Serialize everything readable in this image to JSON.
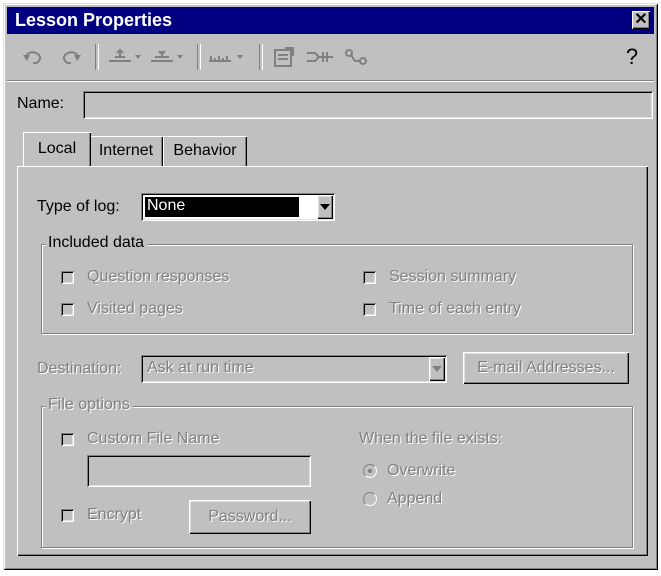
{
  "window": {
    "title": "Lesson Properties",
    "close_glyph": "✕"
  },
  "toolbar": {
    "icons": [
      "undo-icon",
      "redo-icon",
      "indent-icon",
      "outdent-icon",
      "measure-icon",
      "properties-icon",
      "flow-icon",
      "link-icon",
      "help-icon"
    ],
    "help_glyph": "?"
  },
  "name_field": {
    "label": "Name:",
    "value": ""
  },
  "tabs": [
    {
      "label": "Local",
      "active": true
    },
    {
      "label": "Internet",
      "active": false
    },
    {
      "label": "Behavior",
      "active": false
    }
  ],
  "log": {
    "label": "Type of log:",
    "value": "None"
  },
  "included_data": {
    "legend": "Included data",
    "question_responses": "Question responses",
    "session_summary": "Session summary",
    "visited_pages": "Visited pages",
    "time_of_each_entry": "Time of each entry"
  },
  "destination": {
    "label": "Destination:",
    "value": "Ask at run time",
    "email_button": "E-mail Addresses..."
  },
  "file_options": {
    "legend": "File options",
    "custom_file_name": "Custom File Name",
    "custom_file_value": "",
    "encrypt": "Encrypt",
    "password_button": "Password...",
    "exists_label": "When the  file exists:",
    "overwrite": "Overwrite",
    "append": "Append"
  },
  "colors": {
    "titlebar": "#000080",
    "face": "#c0c0c0",
    "disabled": "#808080"
  }
}
